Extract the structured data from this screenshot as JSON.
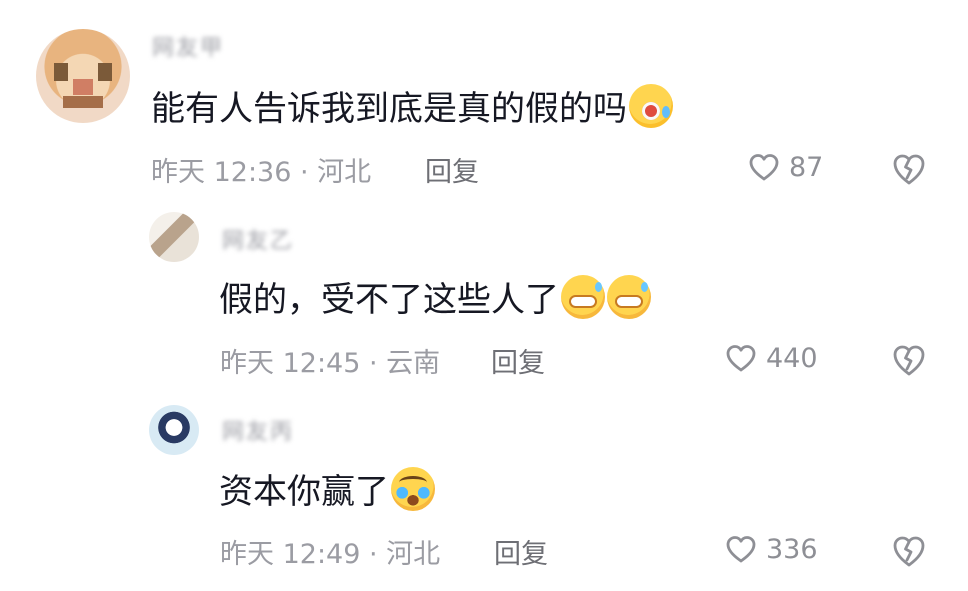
{
  "comments": [
    {
      "username": "网友甲",
      "text": "能有人告诉我到底是真的假的吗",
      "emoji": "shocked-face-emoji",
      "meta": "昨天 12:36 · 河北",
      "reply": "回复",
      "likes": "87",
      "icons": {
        "like": "heart-icon",
        "dislike": "broken-heart-icon"
      }
    },
    {
      "username": "网友乙",
      "text": "假的，受不了这些人了",
      "emoji": [
        "grinning-sweat-emoji",
        "grinning-sweat-emoji"
      ],
      "meta": "昨天 12:45 · 云南",
      "reply": "回复",
      "likes": "440",
      "icons": {
        "like": "heart-icon",
        "dislike": "broken-heart-icon"
      }
    },
    {
      "username": "网友丙",
      "text": "资本你赢了",
      "emoji": "crying-face-emoji",
      "meta": "昨天 12:49 · 河北",
      "reply": "回复",
      "likes": "336",
      "icons": {
        "like": "heart-icon",
        "dislike": "broken-heart-icon"
      }
    }
  ],
  "colors": {
    "text": "#161823",
    "meta": "#9b9ca3",
    "reply": "#6e6f75",
    "icon": "#8e8f95",
    "background": "#ffffff"
  }
}
